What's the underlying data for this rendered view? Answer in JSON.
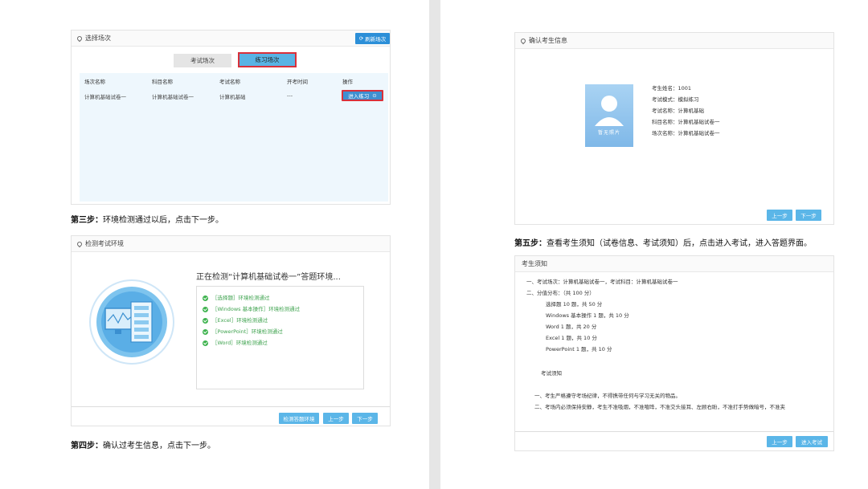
{
  "left": {
    "panel1": {
      "header": "选择场次",
      "refresh_btn": "刷新场次",
      "tabs": [
        "考试场次",
        "练习场次"
      ],
      "columns": [
        "场次名称",
        "科目名称",
        "考试名称",
        "开考时间",
        "操作"
      ],
      "row": [
        "计算机基础试卷一",
        "计算机基础试卷一",
        "计算机基础",
        "---"
      ],
      "action": "进入练习"
    },
    "step3": {
      "bold": "第三步：",
      "text": "环境检测通过以后，点击下一步。"
    },
    "panel2": {
      "header": "检测考试环境",
      "title": "正在检测“计算机基础试卷一”答题环境...",
      "checks": [
        "［选择题］环境检测通过",
        "［Windows 基本操作］环境检测通过",
        "［Excel］环境检测通过",
        "［PowerPoint］环境检测通过",
        "［Word］环境检测通过"
      ],
      "buttons": [
        "检测答题环境",
        "上一步",
        "下一步"
      ]
    },
    "step4": {
      "bold": "第四步：",
      "text": "确认过考生信息，点击下一步。"
    }
  },
  "right": {
    "panel3": {
      "header": "确认考生信息",
      "photo_caption": "暂无照片",
      "info": [
        "考生姓名：1001",
        "考试模式：模拟练习",
        "考试名称：计算机基础",
        "科目名称：计算机基础试卷一",
        "场次名称：计算机基础试卷一"
      ],
      "buttons": [
        "上一步",
        "下一步"
      ]
    },
    "step5": {
      "bold": "第五步：",
      "text": "查看考生须知（试卷信息、考试须知）后，点击进入考试，进入答题界面。"
    },
    "panel4": {
      "header": "考生须知",
      "lines": [
        "一、考试场次：计算机基础试卷一，考试科目：计算机基础试卷一",
        "二、分值分布：（共 100 分）",
        "选择题 10 题，共 50 分",
        "Windows 基本操作 1 题，共 10 分",
        "Word 1 题，共 20 分",
        "Excel 1 题，共 10 分",
        "PowerPoint 1 题，共 10 分",
        "考试须知",
        "一、考生严格遵守考场纪律，不得携带任何与学习无关的物品。",
        "二、考场内必须保持安静，考生不准吸烟，不准喧哗，不准交头接耳、左顾右盼，不准打手势做暗号，不准夹"
      ],
      "buttons": [
        "上一步",
        "进入考试"
      ]
    }
  }
}
